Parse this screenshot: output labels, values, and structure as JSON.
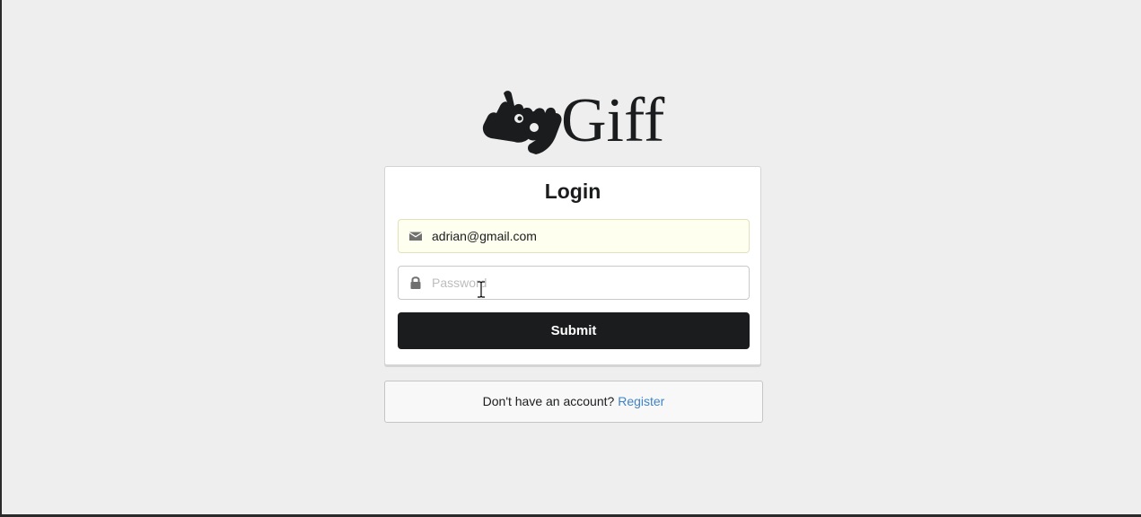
{
  "brand": {
    "name": "Giff",
    "icon": "sign-language-icon"
  },
  "login_form": {
    "title": "Login",
    "email": {
      "value": "adrian@gmail.com",
      "icon": "envelope-icon",
      "autofilled": true
    },
    "password": {
      "placeholder": "Password",
      "value": "",
      "icon": "lock-icon"
    },
    "submit_label": "Submit"
  },
  "register_prompt": {
    "text": "Don't have an account?",
    "link_label": "Register"
  },
  "colors": {
    "background": "#eeeeee",
    "button": "#1b1c1d",
    "link": "#4183c4",
    "autofill": "#fffff0"
  }
}
